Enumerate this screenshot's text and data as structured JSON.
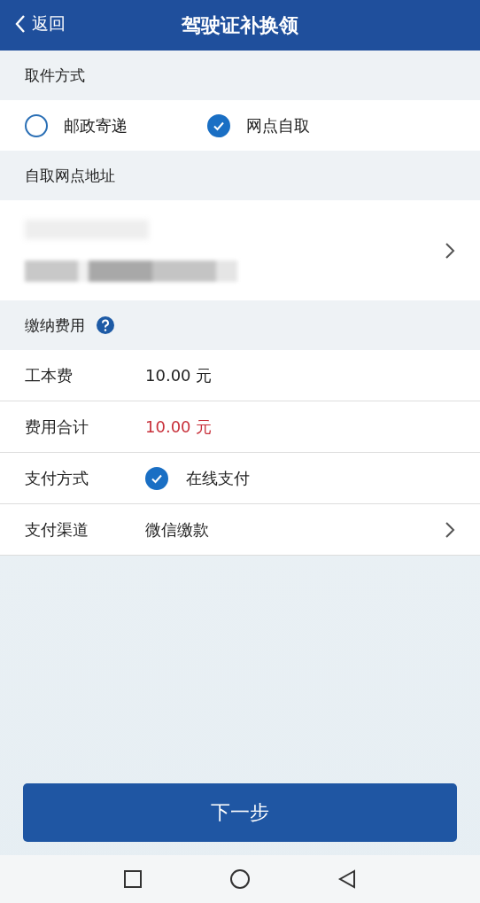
{
  "header": {
    "back": "返回",
    "title": "驾驶证补换领"
  },
  "pickup": {
    "heading": "取件方式",
    "options": [
      {
        "label": "邮政寄递",
        "selected": false
      },
      {
        "label": "网点自取",
        "selected": true
      }
    ]
  },
  "address": {
    "heading": "自取网点地址"
  },
  "fees": {
    "heading": "缴纳费用",
    "rows": [
      {
        "kind": "text",
        "label": "工本费",
        "value": "10.00 元"
      },
      {
        "kind": "total",
        "label": "费用合计",
        "value": "10.00 元"
      },
      {
        "kind": "check",
        "label": "支付方式",
        "value": "在线支付",
        "checked": true
      },
      {
        "kind": "link",
        "label": "支付渠道",
        "value": "微信缴款"
      }
    ]
  },
  "next_button": "下一步"
}
